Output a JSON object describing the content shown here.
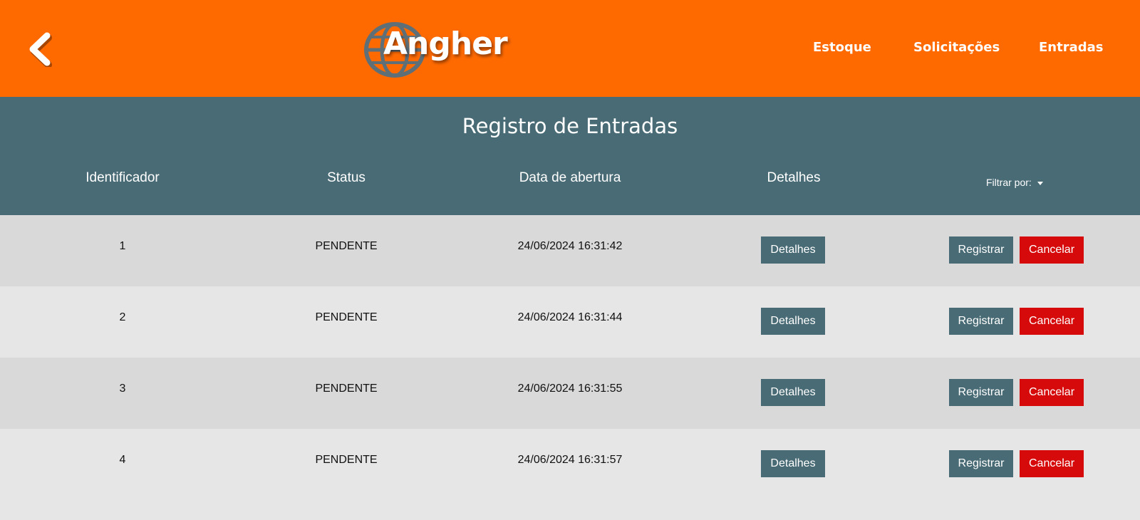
{
  "header": {
    "logo_text": "Angher",
    "nav": [
      "Estoque",
      "Solicitações",
      "Entradas"
    ]
  },
  "page": {
    "title": "Registro de Entradas",
    "columns": [
      "Identificador",
      "Status",
      "Data de abertura",
      "Detalhes"
    ],
    "filter_label": "Filtrar por:"
  },
  "rows": [
    {
      "id": "1",
      "status": "PENDENTE",
      "date": "24/06/2024 16:31:42",
      "details_label": "Detalhes",
      "register_label": "Registrar",
      "cancel_label": "Cancelar"
    },
    {
      "id": "2",
      "status": "PENDENTE",
      "date": "24/06/2024 16:31:44",
      "details_label": "Detalhes",
      "register_label": "Registrar",
      "cancel_label": "Cancelar"
    },
    {
      "id": "3",
      "status": "PENDENTE",
      "date": "24/06/2024 16:31:55",
      "details_label": "Detalhes",
      "register_label": "Registrar",
      "cancel_label": "Cancelar"
    },
    {
      "id": "4",
      "status": "PENDENTE",
      "date": "24/06/2024 16:31:57",
      "details_label": "Detalhes",
      "register_label": "Registrar",
      "cancel_label": "Cancelar"
    }
  ],
  "icons": {
    "back": "chevron-left-icon",
    "logo": "globe-logo-icon",
    "filter": "caret-down-icon"
  },
  "colors": {
    "header_bg": "#ff6a00",
    "subheader_bg": "#486b75",
    "row_dark": "#d9d9d9",
    "row_light": "#e6e6e6",
    "button_primary": "#486b75",
    "button_danger": "#d60a0a"
  }
}
